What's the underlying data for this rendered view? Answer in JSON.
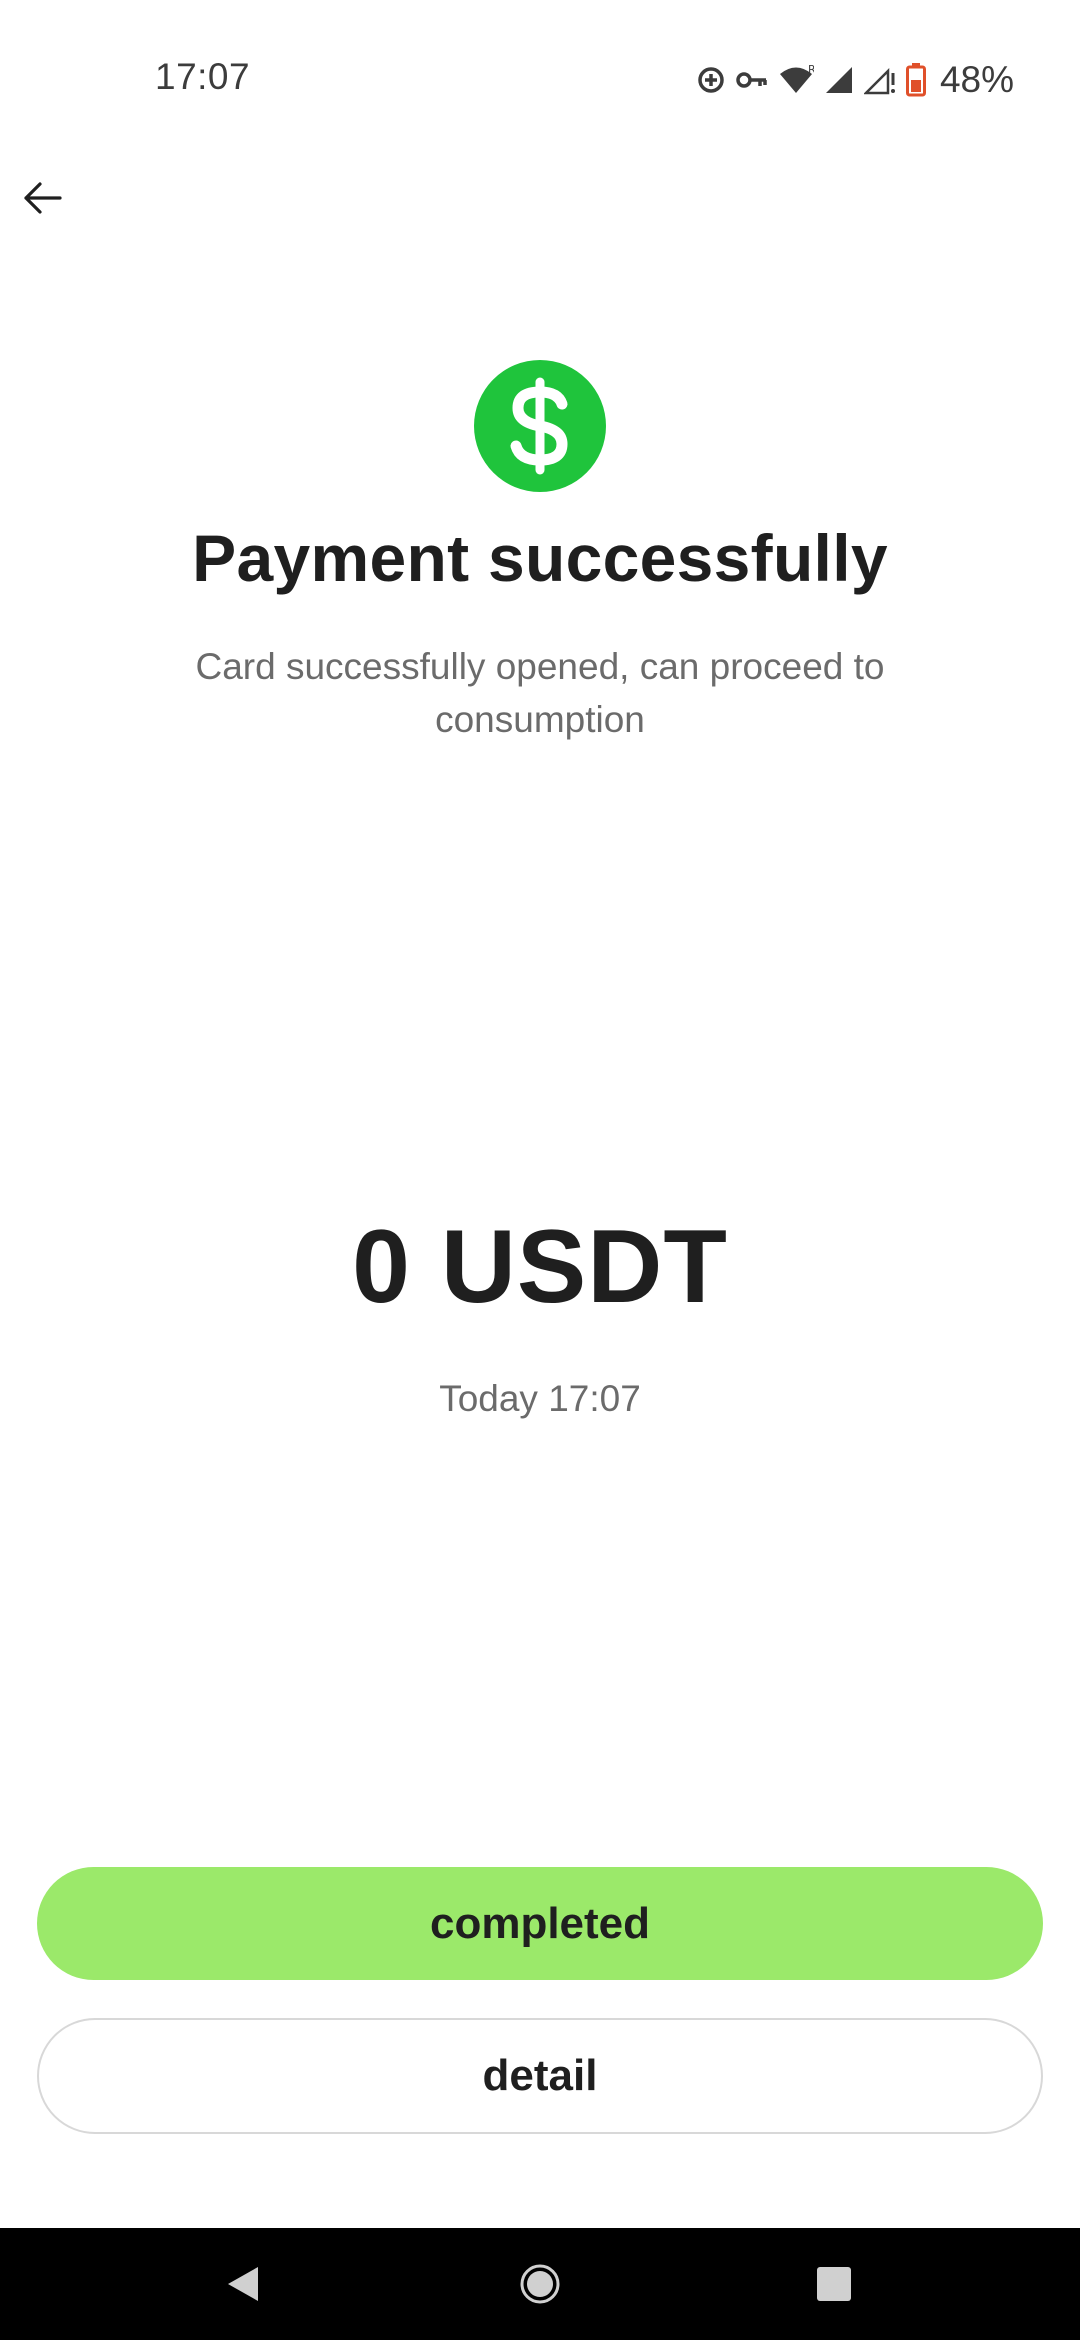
{
  "status_bar": {
    "time": "17:07",
    "battery_percent": "48%",
    "icons": [
      "data-saver-icon",
      "vpn-key-icon",
      "wifi-icon",
      "signal-roaming-icon",
      "signal-no-data-icon",
      "battery-icon"
    ]
  },
  "header": {
    "back_icon": "arrow-left-icon"
  },
  "result": {
    "icon": "dollar-circle-icon",
    "icon_color": "#1fc43c",
    "title": "Payment successfully",
    "subtitle": "Card successfully opened, can proceed to consumption",
    "amount": "0 USDT",
    "date": "Today 17:07"
  },
  "actions": {
    "completed_label": "completed",
    "completed_color": "#9be96a",
    "detail_label": "detail"
  },
  "nav_bar": {
    "icons": [
      "nav-back-icon",
      "nav-home-icon",
      "nav-recents-icon"
    ]
  }
}
